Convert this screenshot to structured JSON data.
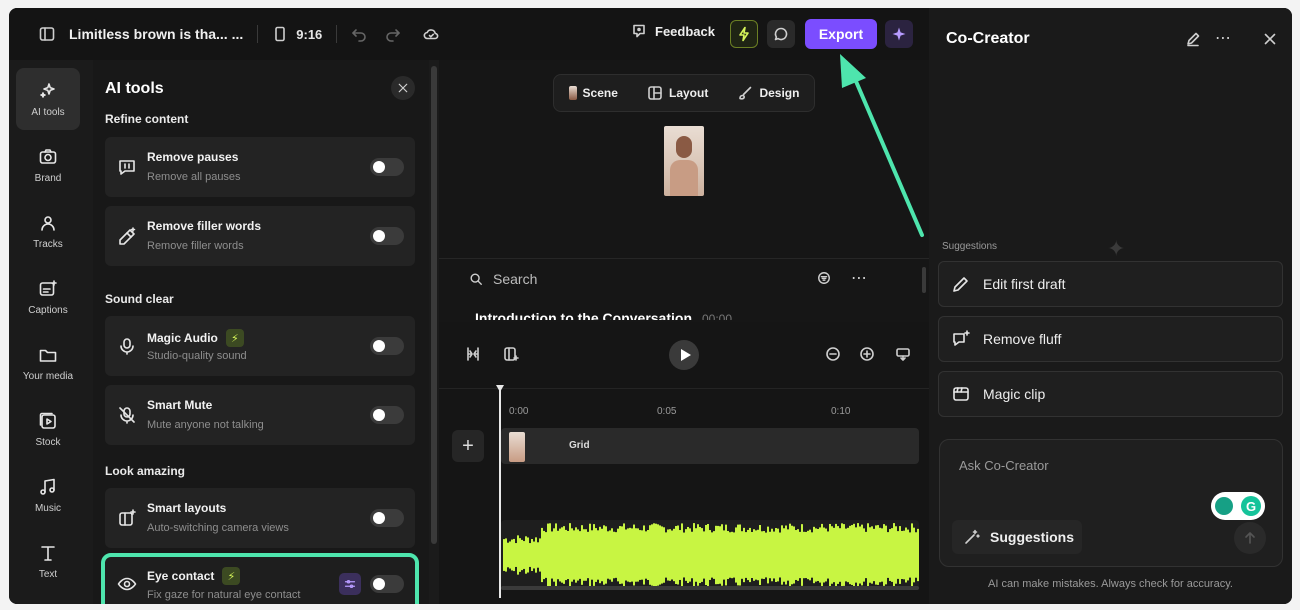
{
  "topbar": {
    "project_title": "Limitless brown is tha... ...",
    "aspect_ratio": "9:16",
    "feedback_label": "Feedback",
    "export_label": "Export"
  },
  "rail": {
    "items": [
      {
        "label": "AI tools",
        "icon": "sparkle-icon"
      },
      {
        "label": "Brand",
        "icon": "camera-icon"
      },
      {
        "label": "Tracks",
        "icon": "people-icon"
      },
      {
        "label": "Captions",
        "icon": "captions-icon"
      },
      {
        "label": "Your media",
        "icon": "folder-icon"
      },
      {
        "label": "Stock",
        "icon": "stock-play-icon"
      },
      {
        "label": "Music",
        "icon": "music-icon"
      },
      {
        "label": "Text",
        "icon": "text-icon"
      }
    ]
  },
  "ai_tools": {
    "title": "AI tools",
    "sections": {
      "refine": "Refine content",
      "sound": "Sound clear",
      "look": "Look amazing"
    },
    "cards": [
      {
        "title": "Remove pauses",
        "subtitle": "Remove all pauses"
      },
      {
        "title": "Remove filler words",
        "subtitle": "Remove filler words"
      },
      {
        "title": "Magic Audio",
        "subtitle": "Studio-quality sound"
      },
      {
        "title": "Smart Mute",
        "subtitle": "Mute anyone not talking"
      },
      {
        "title": "Smart layouts",
        "subtitle": "Auto-switching camera views"
      },
      {
        "title": "Eye contact",
        "subtitle": "Fix gaze for natural eye contact"
      }
    ]
  },
  "center": {
    "scene_tabs": [
      "Scene",
      "Layout",
      "Design"
    ],
    "search_placeholder": "Search",
    "transcript_heading": "Introduction to the Conversation",
    "transcript_time": "00:00",
    "ruler": [
      "0:00",
      "0:05",
      "0:10"
    ],
    "track_label": "Grid"
  },
  "cocreator": {
    "title": "Co-Creator",
    "suggestions_label": "Suggestions",
    "suggestions": [
      "Edit first draft",
      "Remove fluff",
      "Magic clip"
    ],
    "ask_placeholder": "Ask Co-Creator",
    "suggestions_button": "Suggestions",
    "disclaimer": "AI can make mistakes. Always check for accuracy."
  },
  "colors": {
    "accent": "#7b4dff",
    "highlight": "#4ee5ad",
    "waveform": "#c8f542"
  }
}
